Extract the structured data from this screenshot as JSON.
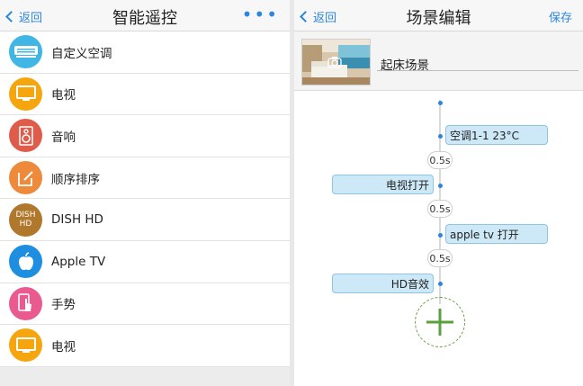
{
  "left": {
    "back_label": "返回",
    "title": "智能遥控",
    "more_glyph": "•••",
    "items": [
      {
        "label": "自定义空调",
        "icon": "air-conditioner-icon",
        "color": "#3fb6e4"
      },
      {
        "label": "电视",
        "icon": "tv-icon",
        "color": "#f5a60e"
      },
      {
        "label": "音响",
        "icon": "speaker-icon",
        "color": "#df5b4a"
      },
      {
        "label": "顺序排序",
        "icon": "edit-icon",
        "color": "#ee8a3c"
      },
      {
        "label": "DISH HD",
        "icon": "dish-hd-icon",
        "color": "#b0782c",
        "icon_text": "DISH\nHD"
      },
      {
        "label": "Apple TV",
        "icon": "apple-icon",
        "color": "#1e8ee0"
      },
      {
        "label": "手势",
        "icon": "gesture-icon",
        "color": "#e95a8e"
      },
      {
        "label": "电视",
        "icon": "tv-icon",
        "color": "#f5a60e"
      }
    ]
  },
  "right": {
    "back_label": "返回",
    "title": "场景编辑",
    "save_label": "保存",
    "scene_name": "起床场景",
    "actions": [
      {
        "label": "空调1-1 23°C",
        "side": "right"
      },
      {
        "label": "0.5s",
        "type": "delay"
      },
      {
        "label": "电视打开",
        "side": "left"
      },
      {
        "label": "0.5s",
        "type": "delay"
      },
      {
        "label": "apple tv 打开",
        "side": "right"
      },
      {
        "label": "0.5s",
        "type": "delay"
      },
      {
        "label": "HD音效",
        "side": "left"
      }
    ]
  },
  "colors": {
    "accent": "#2b86e0",
    "action_bg": "#cde9f7",
    "add_green": "#5aa03c"
  }
}
